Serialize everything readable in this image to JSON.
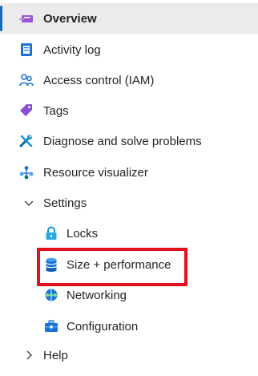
{
  "nav": {
    "overview": "Overview",
    "activity_log": "Activity log",
    "access_control": "Access control (IAM)",
    "tags": "Tags",
    "diagnose": "Diagnose and solve problems",
    "resource_visualizer": "Resource visualizer",
    "settings": "Settings",
    "settings_children": {
      "locks": "Locks",
      "size_performance": "Size + performance",
      "networking": "Networking",
      "configuration": "Configuration"
    },
    "help": "Help"
  },
  "icons": {
    "overview": "overview-icon",
    "activity_log": "activity-log-icon",
    "access_control": "access-control-icon",
    "tags": "tag-icon",
    "diagnose": "wrench-icon",
    "resource_visualizer": "resource-visualizer-icon",
    "settings": "chevron-down-icon",
    "locks": "lock-icon",
    "size_performance": "database-icon",
    "networking": "networking-icon",
    "configuration": "toolbox-icon",
    "help": "chevron-right-icon"
  },
  "colors": {
    "selected_background": "#ebebeb",
    "selected_indicator": "#0f6cbd",
    "highlight_border": "#e3101e",
    "text": "#242424"
  }
}
